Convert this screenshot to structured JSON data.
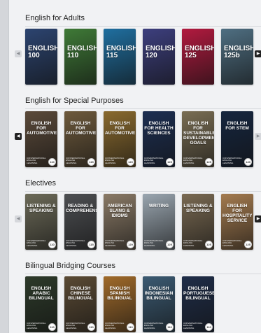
{
  "sections": [
    {
      "title": "English for Adults",
      "books": [
        {
          "label": "ENGLISH\n100",
          "style": "adult"
        },
        {
          "label": "ENGLISH\n110",
          "style": "adult"
        },
        {
          "label": "ENGLISH\n115",
          "style": "adult"
        },
        {
          "label": "ENGLISH\n120",
          "style": "adult"
        },
        {
          "label": "ENGLISH\n125",
          "style": "adult"
        },
        {
          "label": "ENGLISH\n125b",
          "style": "adult"
        }
      ],
      "colors": [
        "#2c4470",
        "#3f7a37",
        "#1f6fa0",
        "#3d3f7e",
        "#b21a3f",
        "#4f6f82"
      ]
    },
    {
      "title": "English for Special Purposes",
      "books": [
        {
          "label": "ENGLISH FOR AUTOMOTIVE",
          "level": "110"
        },
        {
          "label": "ENGLISH FOR AUTOMOTIVE",
          "level": "115"
        },
        {
          "label": "ENGLISH FOR AUTOMOTIVE",
          "level": "120"
        },
        {
          "label": "ENGLISH FOR HEALTH SCIENCES",
          "level": "125"
        },
        {
          "label": "ENGLISH FOR SUSTAINABLE DEVELOPMENT GOALS",
          "level": "125"
        },
        {
          "label": "ENGLISH FOR STEM",
          "level": "140"
        }
      ],
      "colors": [
        "#5b4a3a",
        "#6e5a3c",
        "#8a6a2e",
        "#1d2f52",
        "#7a6e54",
        "#16263f"
      ]
    },
    {
      "title": "Electives",
      "books": [
        {
          "label": "LISTENING & SPEAKING",
          "level": "110"
        },
        {
          "label": "READING & COMPREHENSION",
          "level": "115"
        },
        {
          "label": "AMERICAN SLANG & IDIOMS",
          "level": "120"
        },
        {
          "label": "WRITING",
          "level": "125"
        },
        {
          "label": "LISTENING & SPEAKING",
          "level": "125"
        },
        {
          "label": "ENGLISH FOR HOSPITALITY SERVICE",
          "level": "125"
        }
      ],
      "colors": [
        "#6c6a58",
        "#4d4f52",
        "#8a7a66",
        "#9aa6b0",
        "#7a6a52",
        "#a47b4f"
      ]
    },
    {
      "title": "Bilingual Bridging Courses",
      "books": [
        {
          "label": "ENGLISH ARABIC BILINGUAL",
          "level": "110"
        },
        {
          "label": "ENGLISH CHINESE BILINGUAL",
          "level": "110"
        },
        {
          "label": "ENGLISH SPANISH BILINGUAL",
          "level": "110"
        },
        {
          "label": "ENGLISH INDONESIAN BILINGUAL",
          "level": "110"
        },
        {
          "label": "ENGLISH PORTUGUESE BILINGUAL",
          "level": "110"
        }
      ],
      "colors": [
        "#2d3a2a",
        "#5a4a34",
        "#a06a2a",
        "#3b5a72",
        "#1f2d48"
      ]
    }
  ],
  "book_foot_text": "CONVERSATIONAL ENGLISH LEARNING",
  "icons": {
    "prev": "chevron-left-icon",
    "next": "chevron-right-icon"
  },
  "glyphs": {
    "prev": "◀",
    "next": "▶"
  }
}
